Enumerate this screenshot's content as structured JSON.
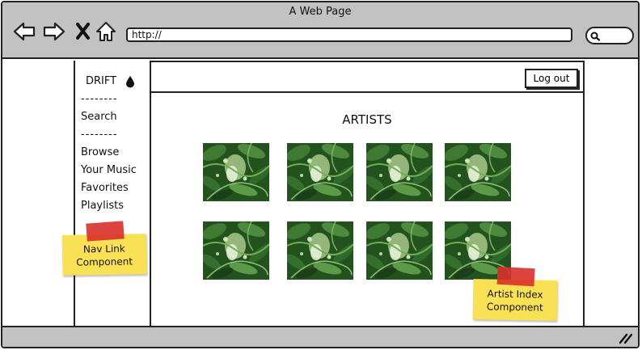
{
  "window": {
    "title": "A Web Page",
    "url": "http://"
  },
  "sidebar": {
    "brand": "DRIFT",
    "divider": "--------",
    "search_label": "Search",
    "nav_items": [
      "Browse",
      "Your Music",
      "Favorites",
      "Playlists"
    ]
  },
  "header": {
    "logout_label": "Log out"
  },
  "main": {
    "title": "ARTISTS"
  },
  "notes": {
    "nav_link": [
      "Nav Link",
      "Component"
    ],
    "artist_index": [
      "Artist Index",
      "Component"
    ]
  },
  "colors": {
    "chrome": "#c2c2c2",
    "sticky_note": "#f9e155",
    "tape": "#d9302a",
    "foliage_dark": "#1f4a1c",
    "foliage_light": "#8fbf6a"
  },
  "icons": [
    "back-arrow-icon",
    "forward-arrow-icon",
    "close-x-icon",
    "home-icon",
    "search-icon",
    "drop-icon",
    "resize-grip-icon"
  ]
}
